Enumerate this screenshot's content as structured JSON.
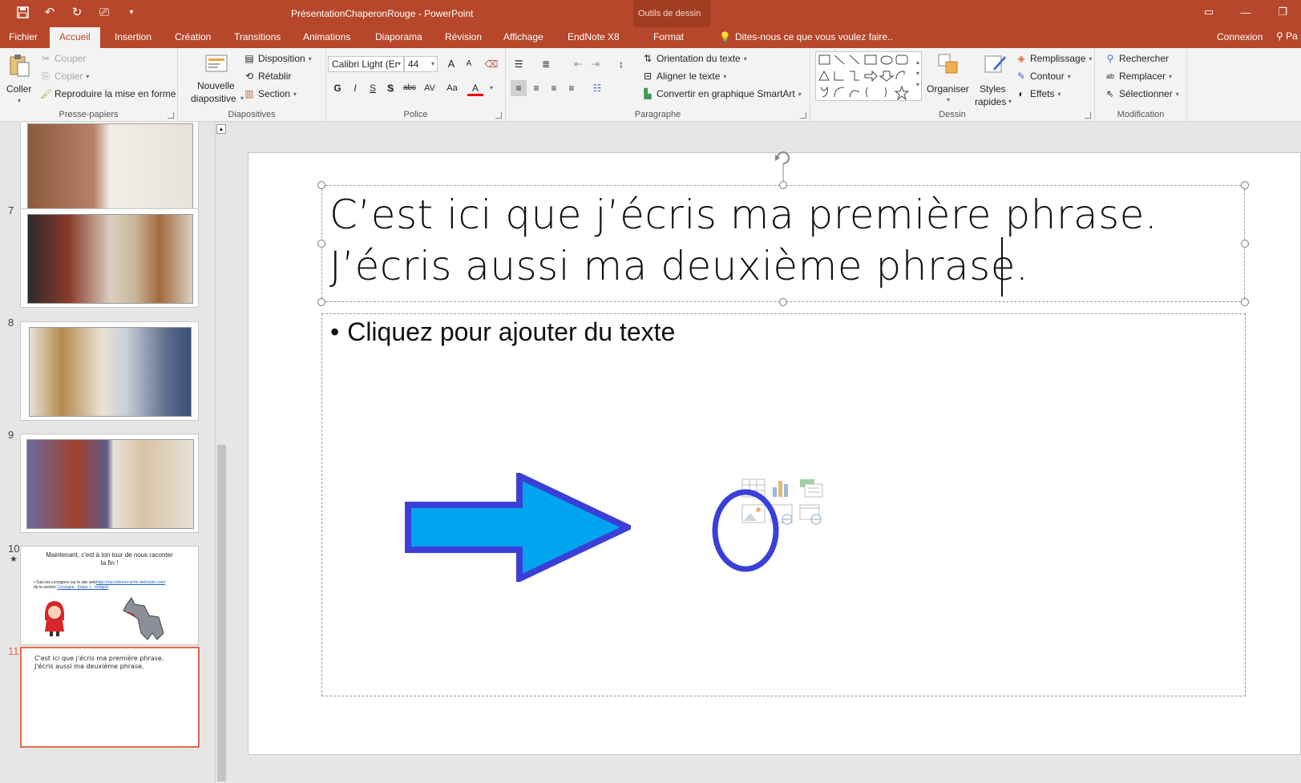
{
  "app": {
    "doc_title": "PrésentationChaperonRouge - PowerPoint",
    "context_group": "Outils de dessin"
  },
  "tabs": [
    {
      "label": "Fichier"
    },
    {
      "label": "Accueil"
    },
    {
      "label": "Insertion"
    },
    {
      "label": "Création"
    },
    {
      "label": "Transitions"
    },
    {
      "label": "Animations"
    },
    {
      "label": "Diaporama"
    },
    {
      "label": "Révision"
    },
    {
      "label": "Affichage"
    },
    {
      "label": "EndNote X8"
    },
    {
      "label": "Format"
    }
  ],
  "tell_me": "Dites-nous ce que vous voulez faire..",
  "sign_in": "Connexion",
  "share": "Pa",
  "ribbon": {
    "clipboard": {
      "label": "Presse-papiers",
      "paste": "Coller",
      "cut": "Couper",
      "copy": "Copier",
      "format_painter": "Reproduire la mise en forme"
    },
    "slides": {
      "label": "Diapositives",
      "new_slide_1": "Nouvelle",
      "new_slide_2": "diapositive",
      "layout": "Disposition",
      "reset": "Rétablir",
      "section": "Section"
    },
    "font": {
      "label": "Police",
      "font_name": "Calibri Light (Er",
      "font_size": "44",
      "bold": "G",
      "italic": "I",
      "underline": "S",
      "shadow": "S",
      "strike": "abc",
      "spacing": "AV",
      "case": "Aa",
      "color": "A",
      "grow": "A",
      "shrink": "A"
    },
    "paragraph": {
      "label": "Paragraphe",
      "text_direction": "Orientation du texte",
      "align_text": "Aligner le texte",
      "smartart": "Convertir en graphique SmartArt"
    },
    "drawing": {
      "label": "Dessin",
      "arrange": "Organiser",
      "quick_styles_1": "Styles",
      "quick_styles_2": "rapides",
      "fill": "Remplissage",
      "outline": "Contour",
      "effects": "Effets"
    },
    "editing": {
      "label": "Modification",
      "find": "Rechercher",
      "replace": "Remplacer",
      "select": "Sélectionner"
    }
  },
  "thumbnails": [
    {
      "num": ""
    },
    {
      "num": "7"
    },
    {
      "num": "8"
    },
    {
      "num": "9"
    },
    {
      "num": "10",
      "star": "★",
      "title_line1": "Maintenant, c'est à ton tour de nous raconter",
      "title_line2": "ta fin !",
      "bullet_1": "• Suis les consignes sur le site web",
      "link_1": "https://racontemoi-ta-fin.webnode.com/",
      "bullet_2": "de la section",
      "link_2": "Consigne : Étape 1 : Intégrer"
    },
    {
      "num": "11",
      "line1": "C'est ici que j'écris ma première phrase.",
      "line2": "J'écris aussi ma deuxième phrase."
    }
  ],
  "slide": {
    "title_line1": "C’est ici que j’écris ma première phrase.",
    "title_line2": "J’écris aussi ma deuxième phrase. ",
    "bullet_char": "•",
    "placeholder": "Cliquez pour ajouter du texte"
  },
  "colors": {
    "accent": "#b7472a",
    "arrow_fill": "#00a4ef",
    "arrow_stroke": "#3b3fd8",
    "circle_stroke": "#3b3fd8",
    "selected_thumb": "#e06a4f"
  }
}
